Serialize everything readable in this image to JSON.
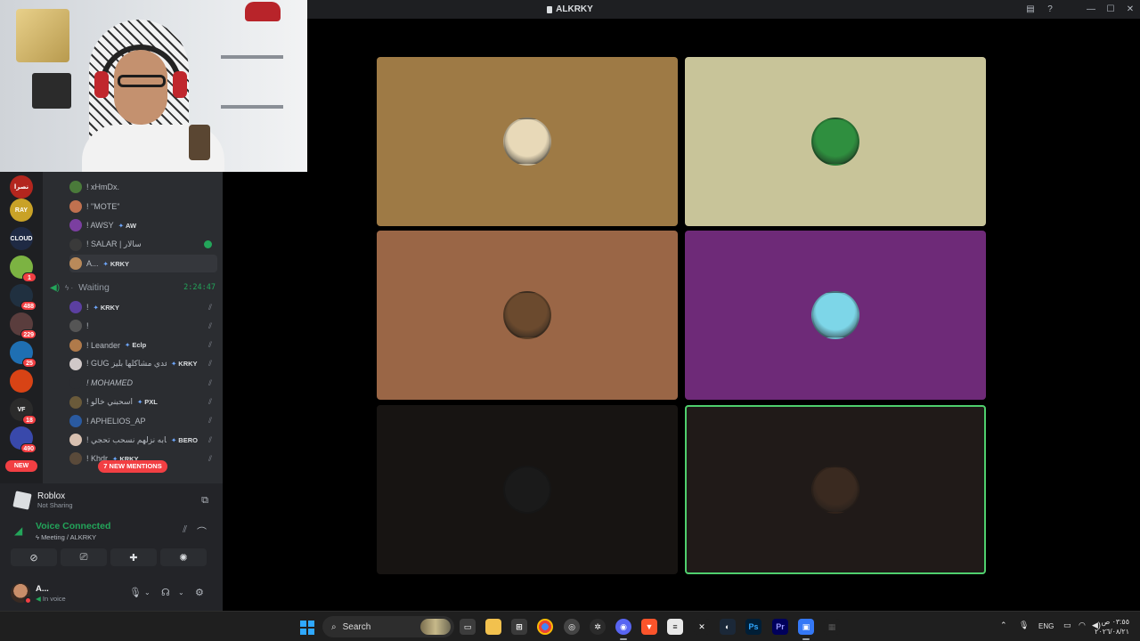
{
  "window": {
    "title": "ALKRKY"
  },
  "servers": [
    {
      "label": "نصرا",
      "color": "#b3261e",
      "badge": ""
    },
    {
      "label": "RAY",
      "color": "#c9a227",
      "badge": ""
    },
    {
      "label": "CLOUD",
      "color": "#1f2a44",
      "badge": ""
    },
    {
      "label": "",
      "color": "#7cb342",
      "badge": "1"
    },
    {
      "label": "",
      "color": "#203040",
      "badge": "488"
    },
    {
      "label": "",
      "color": "#5a3d3d",
      "badge": "229"
    },
    {
      "label": "",
      "color": "#1f6fb2",
      "badge": "25"
    },
    {
      "label": "",
      "color": "#d84315",
      "badge": ""
    },
    {
      "label": "VF",
      "color": "#2b2b2b",
      "badge": "18"
    },
    {
      "label": "",
      "color": "#3949ab",
      "badge": "490"
    }
  ],
  "rail": {
    "new_label": "NEW"
  },
  "members_top": [
    {
      "name": "! xHmDx.",
      "tag": "",
      "color": "#4a7a3a"
    },
    {
      "name": "! \"MOTE\"",
      "tag": "",
      "color": "#c0714f"
    },
    {
      "name": "! AWSY",
      "tag": "AW",
      "color": "#7b3fa0"
    },
    {
      "name": "! SALAR | سالار",
      "tag": "",
      "color": "#3a3a3a"
    },
    {
      "name": "A...",
      "tag": "KRKY",
      "color": "#b98a5a"
    }
  ],
  "voice_channel": {
    "name": "Waiting",
    "time": "2:24:47"
  },
  "members_waiting": [
    {
      "name": "!",
      "tag": "KRKY",
      "color": "#5b3fa0",
      "italic": false
    },
    {
      "name": "!",
      "tag": "",
      "color": "#555555",
      "italic": false
    },
    {
      "name": "! Leander",
      "tag": "Eclp",
      "color": "#b07a4a",
      "italic": false
    },
    {
      "name": "! GUG عدي مشاكلها بليز",
      "tag": "KRKY",
      "color": "#d0c8c8",
      "italic": false
    },
    {
      "name": "! MOHAMED",
      "tag": "",
      "color": "#2b2d31",
      "italic": true
    },
    {
      "name": "! اسحبني خالو",
      "tag": "PXL",
      "color": "#6a5a3a",
      "italic": false
    },
    {
      "name": "! APHELIOS_AP",
      "tag": "",
      "color": "#2a5aa0",
      "italic": false
    },
    {
      "name": "! يابه نزلهم نسحب تحجي",
      "tag": "BERO",
      "color": "#d8c0b0",
      "italic": false
    },
    {
      "name": "! Khdr",
      "tag": "KRKY",
      "color": "#5a4a3a",
      "italic": false
    }
  ],
  "mentions_pill": "7 NEW MENTIONS",
  "activity": {
    "title": "Roblox",
    "subtitle": "Not Sharing"
  },
  "voice": {
    "status": "Voice Connected",
    "location": "Meeting / ALKRKY"
  },
  "user": {
    "name": "A...",
    "status": "In voice"
  },
  "tiles": [
    {
      "bg": "#9e7a45",
      "avatar": "#e8d9b8",
      "speaking": false
    },
    {
      "bg": "#c8c499",
      "avatar": "#2f8f3f",
      "speaking": false
    },
    {
      "bg": "#9a6646",
      "avatar": "#6b4a2e",
      "speaking": false
    },
    {
      "bg": "#6e2a78",
      "avatar": "#7dd6e8",
      "speaking": false
    },
    {
      "bg": "#171412",
      "avatar": "#1a1a1a",
      "speaking": false
    },
    {
      "bg": "#201a18",
      "avatar": "#3a2a20",
      "speaking": true
    }
  ],
  "taskbar": {
    "search_label": "Search",
    "lang": "ENG",
    "time": "٠٣:٥٥ ص",
    "date": "٢٠٢٦/٠٨/٢١"
  }
}
